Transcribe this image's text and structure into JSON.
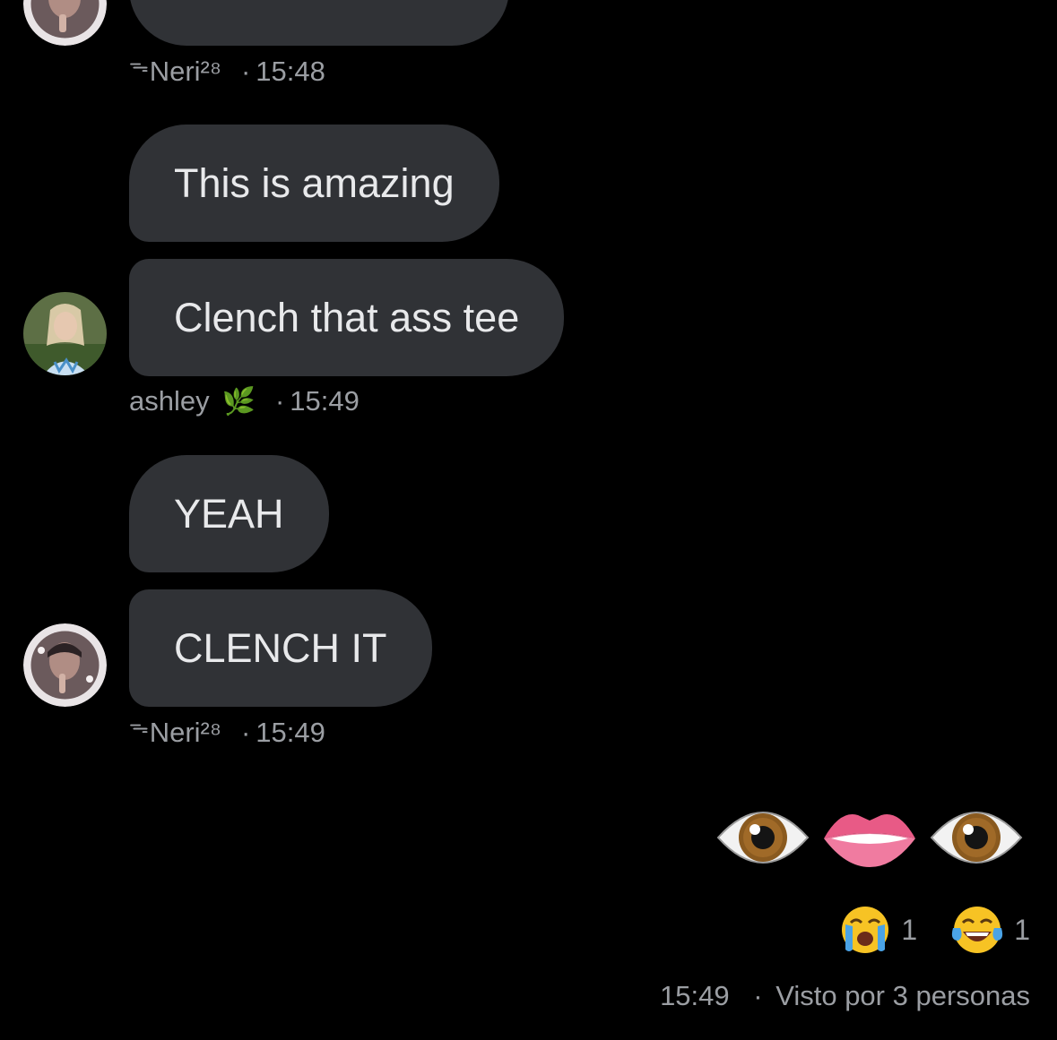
{
  "messages": [
    {
      "id": "m0",
      "text": "",
      "partial": true
    },
    {
      "id": "m1",
      "text": "This is amazing"
    },
    {
      "id": "m2",
      "text": "Clench that ass tee"
    },
    {
      "id": "m3",
      "text": "YEAH"
    },
    {
      "id": "m4",
      "text": "CLENCH IT"
    }
  ],
  "meta": [
    {
      "crown": "ᯓ",
      "sender": "Neri²⁸",
      "sep": "·",
      "time": "15:48"
    },
    {
      "sender": "ashley",
      "badge": "🌿",
      "sep": "·",
      "time": "15:49"
    },
    {
      "crown": "ᯓ",
      "sender": "Neri²⁸",
      "sep": "·",
      "time": "15:49"
    }
  ],
  "outgoing": {
    "emojis": [
      "eye-icon",
      "lips-icon",
      "eye-icon"
    ]
  },
  "reactions": [
    {
      "icon": "crying-face-icon",
      "count": "1"
    },
    {
      "icon": "tears-of-joy-icon",
      "count": "1"
    }
  ],
  "footer": {
    "time": "15:49",
    "sep": "·",
    "seen_text": "Visto por 3 personas"
  },
  "colors": {
    "background": "#000000",
    "bubble": "#303236",
    "bubble_text": "#e8e9eb",
    "meta_text": "#9b9ea3"
  }
}
